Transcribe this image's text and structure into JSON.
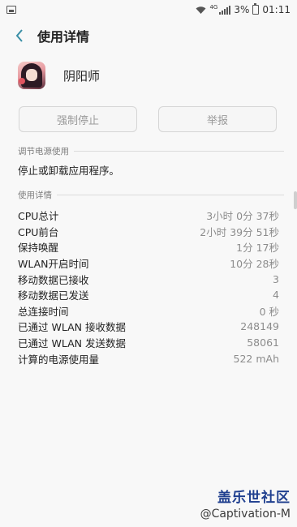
{
  "status_bar": {
    "network_badge": "4G",
    "battery": "3%",
    "time": "01:11"
  },
  "header": {
    "title": "使用详情"
  },
  "app": {
    "name": "阴阳师"
  },
  "buttons": {
    "force_stop": "强制停止",
    "report": "举报"
  },
  "power_section": {
    "title": "调节电源使用",
    "text": "停止或卸载应用程序。"
  },
  "usage_section": {
    "title": "使用详情",
    "rows": [
      {
        "label": "CPU总计",
        "value": "3小时 0分 37秒"
      },
      {
        "label": "CPU前台",
        "value": "2小时 39分 51秒"
      },
      {
        "label": "保持唤醒",
        "value": "1分 17秒"
      },
      {
        "label": "WLAN开启时间",
        "value": "10分 28秒"
      },
      {
        "label": "移动数据已接收",
        "value": "3"
      },
      {
        "label": "移动数据已发送",
        "value": "4"
      },
      {
        "label": "总连接时间",
        "value": "0 秒"
      },
      {
        "label": "已通过 WLAN 接收数据",
        "value": "248149"
      },
      {
        "label": "已通过 WLAN 发送数据",
        "value": "58061"
      },
      {
        "label": "计算的电源使用量",
        "value": "522 mAh"
      }
    ]
  },
  "watermark": {
    "logo": "盖乐世社区",
    "user": "@Captivation-M"
  }
}
